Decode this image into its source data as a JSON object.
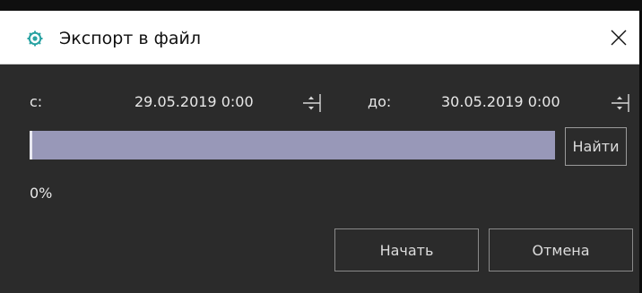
{
  "window": {
    "title": "Экспорт в файл",
    "app_icon": "gear-like-app-icon",
    "close_icon": "close-icon"
  },
  "range": {
    "from_label": "с:",
    "from_value": "29.05.2019 0:00",
    "to_label": "до:",
    "to_value": "30.05.2019 0:00"
  },
  "progress": {
    "value": 0,
    "percent_text": "0%"
  },
  "buttons": {
    "find": "Найти",
    "start": "Начать",
    "cancel": "Отмена"
  },
  "colors": {
    "background": "#2b2b2b",
    "progress_track": "#9898b8",
    "titlebar": "#ffffff",
    "app_icon_accent": "#2aa3a3"
  }
}
